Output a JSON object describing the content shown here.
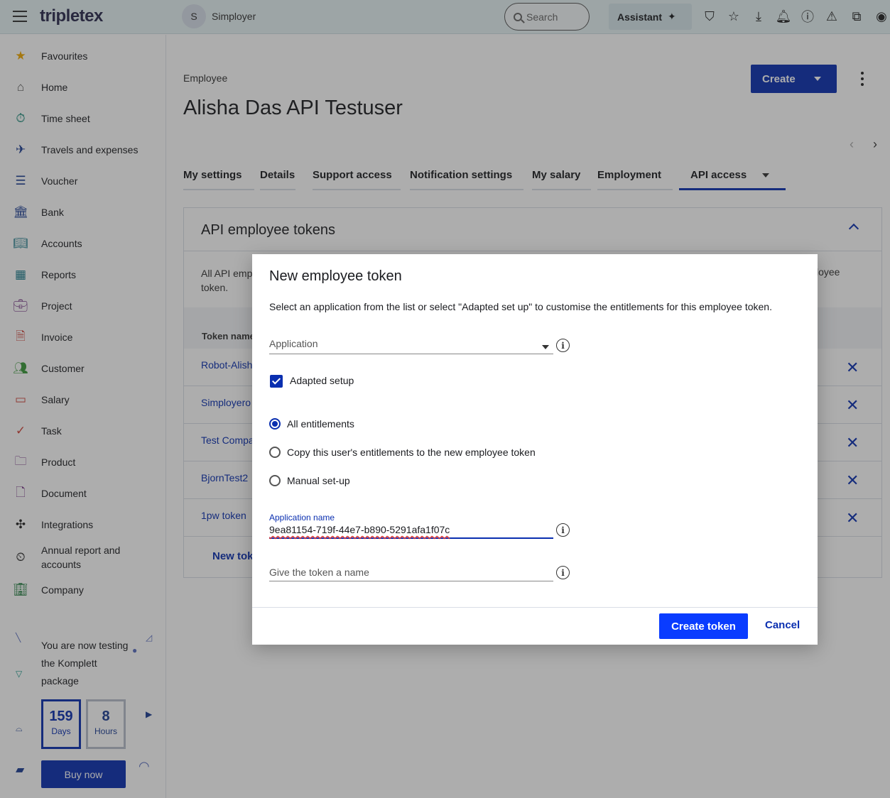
{
  "topbar": {
    "logo": "tripletex",
    "company_initial": "S",
    "company_name": "Simployer",
    "search_placeholder": "Search",
    "assistant_label": "Assistant"
  },
  "sidebar": {
    "items": [
      {
        "label": "Favourites",
        "icon": "star-icon",
        "color": "#f0a800"
      },
      {
        "label": "Home",
        "icon": "home-icon",
        "color": "#555555"
      },
      {
        "label": "Time sheet",
        "icon": "stopwatch-icon",
        "color": "#1a8a7a"
      },
      {
        "label": "Travels and expenses",
        "icon": "plane-icon",
        "color": "#1c3e94"
      },
      {
        "label": "Voucher",
        "icon": "voucher-icon",
        "color": "#1c3e94"
      },
      {
        "label": "Bank",
        "icon": "bank-icon",
        "color": "#1c3e94"
      },
      {
        "label": "Accounts",
        "icon": "book-icon",
        "color": "#1a7a8a"
      },
      {
        "label": "Reports",
        "icon": "dashboard-icon",
        "color": "#1a7a8a"
      },
      {
        "label": "Project",
        "icon": "briefcase-icon",
        "color": "#7a3a8a"
      },
      {
        "label": "Invoice",
        "icon": "invoice-icon",
        "color": "#d0453a"
      },
      {
        "label": "Customer",
        "icon": "people-icon",
        "color": "#3a9a3a"
      },
      {
        "label": "Salary",
        "icon": "card-icon",
        "color": "#d0453a"
      },
      {
        "label": "Task",
        "icon": "check-circle-icon",
        "color": "#d0453a"
      },
      {
        "label": "Product",
        "icon": "folder-icon",
        "color": "#7a3a8a"
      },
      {
        "label": "Document",
        "icon": "document-icon",
        "color": "#7a3a8a"
      },
      {
        "label": "Integrations",
        "icon": "puzzle-icon",
        "color": "#222222"
      },
      {
        "label": "Annual report and accounts",
        "icon": "report-clock-icon",
        "color": "#222222"
      },
      {
        "label": "Company",
        "icon": "building-icon",
        "color": "#1a7a3a"
      }
    ],
    "trial_text": "You are now testing the Komplett package",
    "days_value": "159",
    "days_label": "Days",
    "hours_value": "8",
    "hours_label": "Hours",
    "buy_label": "Buy now"
  },
  "main": {
    "breadcrumb": "Employee",
    "title": "Alisha Das API Testuser",
    "create_label": "Create",
    "tabs": [
      {
        "label": "My settings"
      },
      {
        "label": "Details"
      },
      {
        "label": "Support access"
      },
      {
        "label": "Notification settings"
      },
      {
        "label": "My salary"
      },
      {
        "label": "Employment"
      },
      {
        "label": "API access",
        "active": true
      }
    ],
    "panel": {
      "title": "API employee tokens",
      "desc_start": "All API emp",
      "desc_tail": "loyee",
      "desc_line2": "token.",
      "column_token_name": "Token name",
      "rows": [
        {
          "name": "Robot-Alish"
        },
        {
          "name": "Simployero"
        },
        {
          "name": "Test Compa"
        },
        {
          "name": "BjornTest2"
        },
        {
          "name": "1pw token"
        }
      ],
      "new_token_label": "New tok"
    }
  },
  "modal": {
    "title": "New employee token",
    "description": "Select an application from the list or select \"Adapted set up\" to customise the entitlements for this employee token.",
    "application_label": "Application",
    "adapted_setup_label": "Adapted setup",
    "adapted_setup_checked": true,
    "options": [
      {
        "label": "All entitlements",
        "selected": true
      },
      {
        "label": "Copy this user's entitlements to the new employee token",
        "selected": false
      },
      {
        "label": "Manual set-up",
        "selected": false
      }
    ],
    "app_name_label": "Application name",
    "app_name_value": "9ea81154-719f-44e7-b890-5291afa1f07c",
    "token_name_placeholder": "Give the token a name",
    "create_token_label": "Create token",
    "cancel_label": "Cancel"
  }
}
